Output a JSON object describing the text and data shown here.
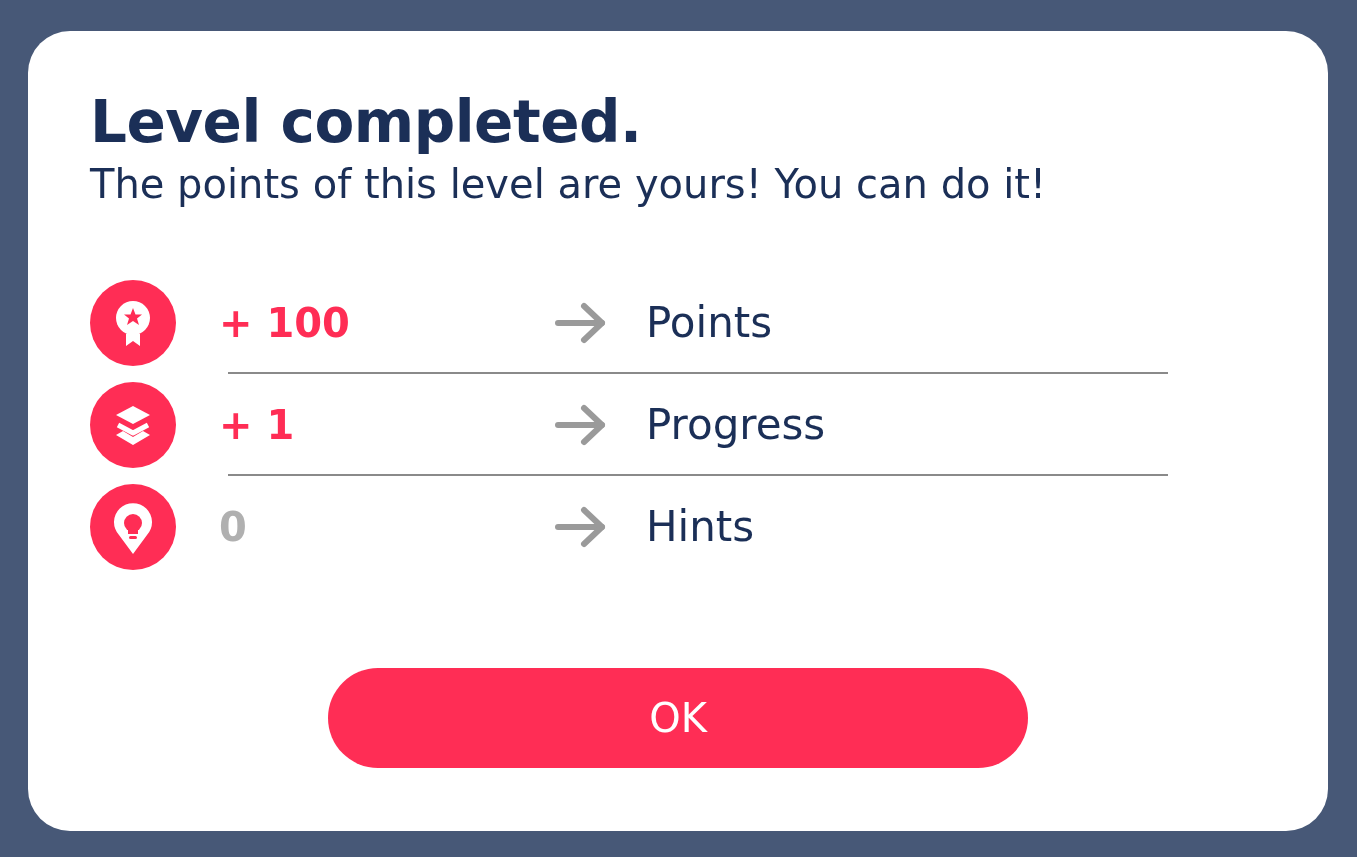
{
  "dialog": {
    "title": "Level completed.",
    "subtitle": "The points of this level are yours! You can do it!",
    "rewards": [
      {
        "kind": "points",
        "value": "+ 100",
        "dimmed": false,
        "label": "Points"
      },
      {
        "kind": "progress",
        "value": "+ 1",
        "dimmed": false,
        "label": "Progress"
      },
      {
        "kind": "hints",
        "value": "0",
        "dimmed": true,
        "label": "Hints"
      }
    ],
    "button": "OK"
  }
}
